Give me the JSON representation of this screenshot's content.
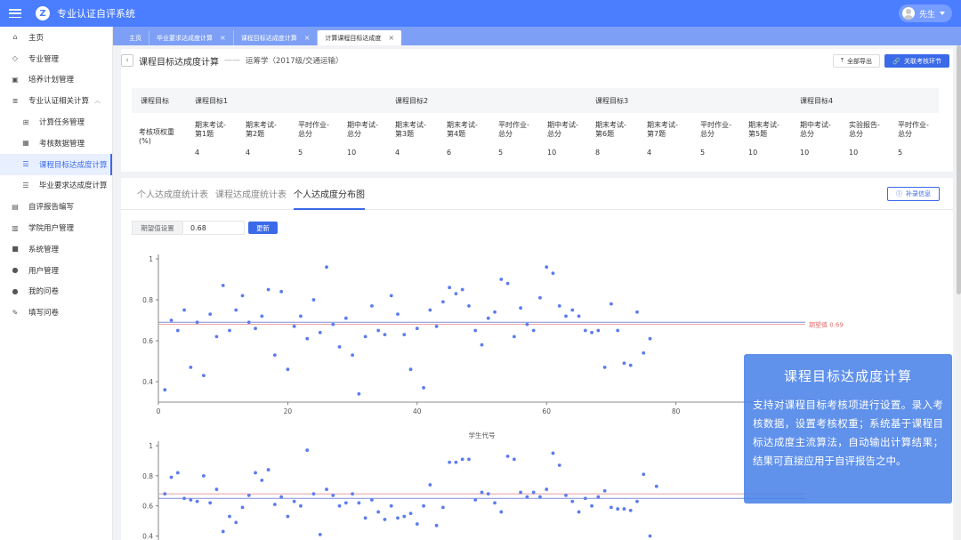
{
  "app": {
    "title": "专业认证自评系统",
    "logo": "Z",
    "user": "先生"
  },
  "sidebar": {
    "items": [
      {
        "label": "主页",
        "icon": "home-icon",
        "sub": false
      },
      {
        "label": "专业管理",
        "icon": "diamond-icon",
        "sub": false
      },
      {
        "label": "培养计划管理",
        "icon": "briefcase-icon",
        "sub": false
      },
      {
        "label": "专业认证相关计算",
        "icon": "layers-icon",
        "sub": false,
        "expanded": true
      },
      {
        "label": "计算任务管理",
        "icon": "tree-icon",
        "sub": true
      },
      {
        "label": "考核数据管理",
        "icon": "grid-icon",
        "sub": true
      },
      {
        "label": "课程目标达成度计算",
        "icon": "stack-icon",
        "sub": true,
        "active": true
      },
      {
        "label": "毕业要求达成度计算",
        "icon": "stack-icon",
        "sub": true
      },
      {
        "label": "自评报告编写",
        "icon": "report-icon",
        "sub": false
      },
      {
        "label": "学院用户管理",
        "icon": "building-icon",
        "sub": false
      },
      {
        "label": "系统管理",
        "icon": "apps-icon",
        "sub": false
      },
      {
        "label": "用户管理",
        "icon": "user-icon",
        "sub": false
      },
      {
        "label": "我的问卷",
        "icon": "user-icon",
        "sub": false
      },
      {
        "label": "填写问卷",
        "icon": "pencil-icon",
        "sub": false
      }
    ]
  },
  "tabs": [
    {
      "label": "主页",
      "closable": false
    },
    {
      "label": "毕业要求达成度计算",
      "closable": true
    },
    {
      "label": "课程目标达成度计算",
      "closable": true
    },
    {
      "label": "计算课程目标达成度",
      "closable": true,
      "active": true
    }
  ],
  "page": {
    "title": "课程目标达成度计算",
    "dash": "——",
    "subtitle": "运筹学（2017级/交通运输）",
    "export_label": "全部导出",
    "link_label": "关联考核环节"
  },
  "weights": {
    "header_first": "课程目标",
    "goals": [
      "课程目标1",
      "课程目标2",
      "课程目标3",
      "课程目标4"
    ],
    "row_label": "考核项权重(%)",
    "items": [
      {
        "label": "期末考试-第1题",
        "value": "4"
      },
      {
        "label": "期末考试-第2题",
        "value": "4"
      },
      {
        "label": "平时作业-总分",
        "value": "5"
      },
      {
        "label": "期中考试-总分",
        "value": "10"
      },
      {
        "label": "期末考试-第3题",
        "value": "4"
      },
      {
        "label": "期末考试-第4题",
        "value": "6"
      },
      {
        "label": "平时作业-总分",
        "value": "5"
      },
      {
        "label": "期中考试-总分",
        "value": "10"
      },
      {
        "label": "期末考试-第6题",
        "value": "8"
      },
      {
        "label": "期末考试-第7题",
        "value": "4"
      },
      {
        "label": "平时作业-总分",
        "value": "5"
      },
      {
        "label": "期末考试-第5题",
        "value": "10"
      },
      {
        "label": "期中考试-总分",
        "value": "10"
      },
      {
        "label": "实验报告-总分",
        "value": "10"
      },
      {
        "label": "平时作业-总分",
        "value": "5"
      }
    ]
  },
  "section_tabs": [
    {
      "label": "个人达成度统计表"
    },
    {
      "label": "课程达成度统计表"
    },
    {
      "label": "个人达成度分布图",
      "active": true
    }
  ],
  "info_btn": "补录信息",
  "expect": {
    "label": "期望值设置",
    "value": "0.68",
    "button": "更新"
  },
  "chart_data": [
    {
      "type": "scatter",
      "xlabel": "学生代号",
      "ylim": [
        0.3,
        1.0
      ],
      "xlim": [
        0,
        100
      ],
      "xticks": [
        0,
        20,
        40,
        60,
        80
      ],
      "yticks": [
        0.4,
        0.6,
        0.8,
        1
      ],
      "expect_line": 0.68,
      "expect_label": "期望值 0.69",
      "avg_line": 0.69,
      "colors": {
        "points": "#5b7cf0",
        "expect": "#e8a0a0",
        "avg": "#7d8fd8"
      },
      "points": [
        [
          1,
          0.36
        ],
        [
          2,
          0.7
        ],
        [
          3,
          0.65
        ],
        [
          4,
          0.75
        ],
        [
          5,
          0.47
        ],
        [
          6,
          0.69
        ],
        [
          7,
          0.43
        ],
        [
          8,
          0.73
        ],
        [
          9,
          0.62
        ],
        [
          10,
          0.87
        ],
        [
          11,
          0.65
        ],
        [
          12,
          0.75
        ],
        [
          13,
          0.82
        ],
        [
          14,
          0.69
        ],
        [
          15,
          0.66
        ],
        [
          16,
          0.72
        ],
        [
          17,
          0.85
        ],
        [
          18,
          0.53
        ],
        [
          19,
          0.84
        ],
        [
          20,
          0.46
        ],
        [
          21,
          0.67
        ],
        [
          22,
          0.72
        ],
        [
          23,
          0.61
        ],
        [
          24,
          0.8
        ],
        [
          25,
          0.64
        ],
        [
          26,
          0.96
        ],
        [
          27,
          0.68
        ],
        [
          28,
          0.57
        ],
        [
          29,
          0.71
        ],
        [
          30,
          0.53
        ],
        [
          31,
          0.34
        ],
        [
          32,
          0.62
        ],
        [
          33,
          0.77
        ],
        [
          34,
          0.65
        ],
        [
          35,
          0.63
        ],
        [
          36,
          0.82
        ],
        [
          37,
          0.73
        ],
        [
          38,
          0.63
        ],
        [
          39,
          0.46
        ],
        [
          40,
          0.66
        ],
        [
          41,
          0.37
        ],
        [
          42,
          0.75
        ],
        [
          43,
          0.67
        ],
        [
          44,
          0.79
        ],
        [
          45,
          0.86
        ],
        [
          46,
          0.83
        ],
        [
          47,
          0.85
        ],
        [
          48,
          0.77
        ],
        [
          49,
          0.65
        ],
        [
          50,
          0.58
        ],
        [
          51,
          0.71
        ],
        [
          52,
          0.74
        ],
        [
          53,
          0.9
        ],
        [
          54,
          0.88
        ],
        [
          55,
          0.62
        ],
        [
          56,
          0.76
        ],
        [
          57,
          0.68
        ],
        [
          58,
          0.65
        ],
        [
          59,
          0.81
        ],
        [
          60,
          0.96
        ],
        [
          61,
          0.93
        ],
        [
          62,
          0.77
        ],
        [
          63,
          0.72
        ],
        [
          64,
          0.75
        ],
        [
          65,
          0.72
        ],
        [
          66,
          0.65
        ],
        [
          67,
          0.64
        ],
        [
          68,
          0.65
        ],
        [
          69,
          0.47
        ],
        [
          70,
          0.78
        ],
        [
          71,
          0.65
        ],
        [
          72,
          0.49
        ],
        [
          73,
          0.48
        ],
        [
          74,
          0.74
        ],
        [
          75,
          0.54
        ],
        [
          76,
          0.61
        ]
      ]
    },
    {
      "type": "scatter",
      "ylim": [
        0.35,
        1.0
      ],
      "yticks": [
        0.4,
        0.6,
        0.8,
        1
      ],
      "expect_line": 0.68,
      "avg_line": 0.65,
      "colors": {
        "points": "#5b7cf0",
        "expect": "#e8a0a0",
        "avg": "#7d8fd8"
      },
      "points": [
        [
          1,
          0.68
        ],
        [
          2,
          0.79
        ],
        [
          3,
          0.82
        ],
        [
          4,
          0.65
        ],
        [
          5,
          0.64
        ],
        [
          6,
          0.63
        ],
        [
          7,
          0.8
        ],
        [
          8,
          0.62
        ],
        [
          9,
          0.71
        ],
        [
          10,
          0.43
        ],
        [
          11,
          0.53
        ],
        [
          12,
          0.49
        ],
        [
          13,
          0.59
        ],
        [
          14,
          0.67
        ],
        [
          15,
          0.82
        ],
        [
          16,
          0.77
        ],
        [
          17,
          0.84
        ],
        [
          18,
          0.61
        ],
        [
          19,
          0.66
        ],
        [
          20,
          0.53
        ],
        [
          21,
          0.63
        ],
        [
          22,
          0.6
        ],
        [
          23,
          0.97
        ],
        [
          24,
          0.68
        ],
        [
          25,
          0.41
        ],
        [
          26,
          0.71
        ],
        [
          27,
          0.67
        ],
        [
          28,
          0.6
        ],
        [
          29,
          0.62
        ],
        [
          30,
          0.68
        ],
        [
          31,
          0.62
        ],
        [
          32,
          0.52
        ],
        [
          33,
          0.64
        ],
        [
          34,
          0.56
        ],
        [
          35,
          0.51
        ],
        [
          36,
          0.6
        ],
        [
          37,
          0.52
        ],
        [
          38,
          0.53
        ],
        [
          39,
          0.55
        ],
        [
          40,
          0.48
        ],
        [
          41,
          0.6
        ],
        [
          42,
          0.74
        ],
        [
          43,
          0.47
        ],
        [
          44,
          0.59
        ],
        [
          45,
          0.89
        ],
        [
          46,
          0.89
        ],
        [
          47,
          0.91
        ],
        [
          48,
          0.91
        ],
        [
          49,
          0.64
        ],
        [
          50,
          0.69
        ],
        [
          51,
          0.68
        ],
        [
          52,
          0.62
        ],
        [
          53,
          0.56
        ],
        [
          54,
          0.93
        ],
        [
          55,
          0.91
        ],
        [
          56,
          0.69
        ],
        [
          57,
          0.66
        ],
        [
          58,
          0.69
        ],
        [
          59,
          0.66
        ],
        [
          60,
          0.71
        ],
        [
          61,
          0.95
        ],
        [
          62,
          0.87
        ],
        [
          63,
          0.67
        ],
        [
          64,
          0.63
        ],
        [
          65,
          0.56
        ],
        [
          66,
          0.65
        ],
        [
          67,
          0.6
        ],
        [
          68,
          0.66
        ],
        [
          69,
          0.7
        ],
        [
          70,
          0.59
        ],
        [
          71,
          0.58
        ],
        [
          72,
          0.58
        ],
        [
          73,
          0.57
        ],
        [
          74,
          0.63
        ],
        [
          75,
          0.81
        ],
        [
          76,
          0.4
        ],
        [
          77,
          0.73
        ]
      ]
    }
  ],
  "overlay": {
    "title": "课程目标达成度计算",
    "body": "支持对课程目标考核项进行设置。录入考核数据，设置考核权重；系统基于课程目标达成度主流算法，自动输出计算结果；结果可直接应用于自评报告之中。"
  }
}
